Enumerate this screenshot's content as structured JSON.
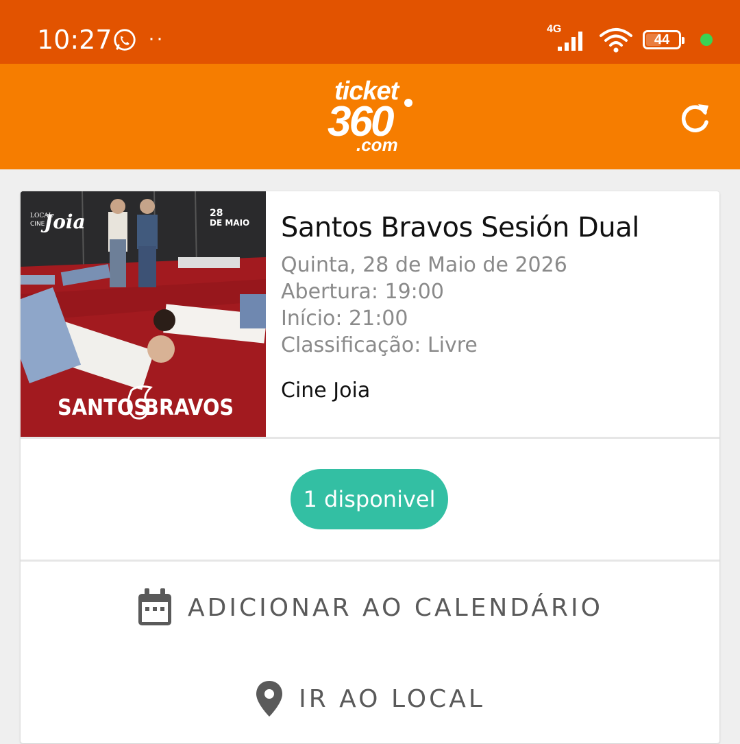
{
  "status_bar": {
    "time": "10:27",
    "dots": "··",
    "network": "4G",
    "battery": "44",
    "battery_level": 0.44
  },
  "app_bar": {
    "logo": {
      "line1": "ticket",
      "line2": "360",
      "line3": ".com"
    },
    "refresh_icon": "refresh-icon"
  },
  "event": {
    "title": "Santos Bravos Sesión Dual",
    "date": "Quinta, 28 de Maio de 2026",
    "opening": "Abertura: 19:00",
    "start": "Início: 21:00",
    "rating": "Classificação: Livre",
    "venue": "Cine Joia",
    "poster": {
      "venue_logo_small": "LOCAL",
      "venue_logo_cine": "CINE",
      "venue_logo": "Joia",
      "date_top": "28",
      "date_bottom": "DE MAIO",
      "band_left": "SANTOS",
      "band_right": "BRAVOS"
    }
  },
  "availability": {
    "label": "1 disponivel",
    "color": "#33bfa3"
  },
  "actions": {
    "calendar_label": "ADICIONAR AO CALENDÁRIO",
    "calendar_icon": "calendar-icon",
    "location_label": "IR AO LOCAL",
    "location_icon": "map-pin-icon"
  },
  "colors": {
    "status_bar": "#e25300",
    "app_bar": "#f67d00",
    "accent": "#33bfa3"
  }
}
